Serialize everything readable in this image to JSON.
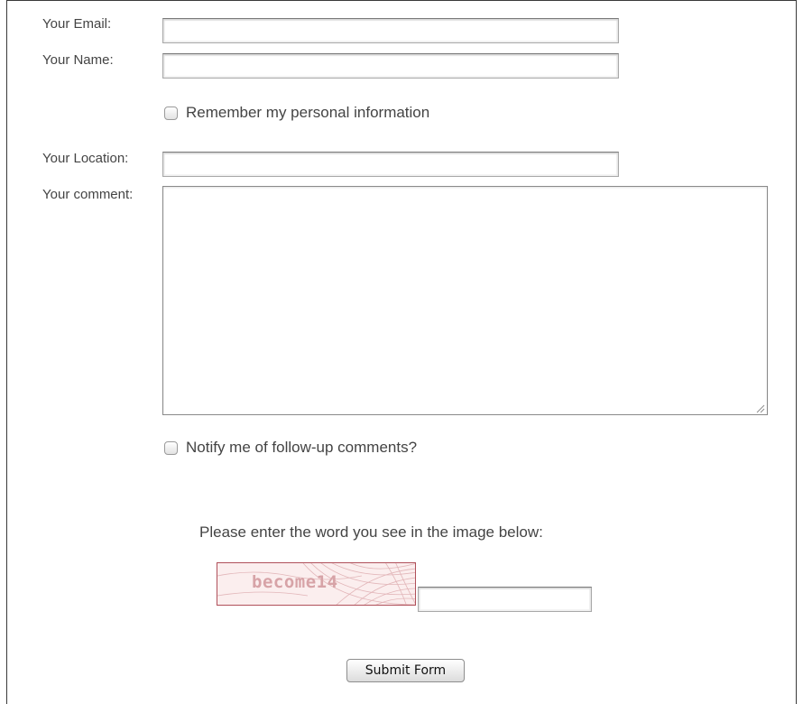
{
  "form": {
    "email": {
      "label": "Your Email:",
      "value": ""
    },
    "name": {
      "label": "Your Name:",
      "value": ""
    },
    "remember": {
      "label": "Remember my personal information",
      "checked": false
    },
    "location": {
      "label": "Your Location:",
      "value": ""
    },
    "comment": {
      "label": "Your comment:",
      "value": ""
    },
    "notify": {
      "label": "Notify me of follow-up comments?",
      "checked": false
    },
    "captcha": {
      "prompt": "Please enter the word you see in the image below:",
      "image_word": "become14",
      "value": ""
    },
    "submit_label": "Submit Form"
  },
  "colors": {
    "label_text": "#444444",
    "captcha_border": "#b0505a",
    "captcha_text": "#d7a3a7"
  },
  "icons": {
    "resize": "resize-grip-icon"
  }
}
